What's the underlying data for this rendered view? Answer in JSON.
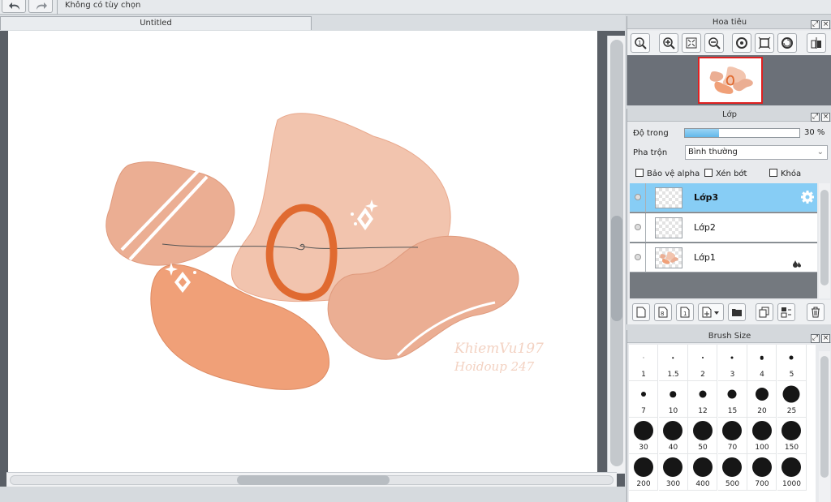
{
  "toolbar": {
    "undo_icon": "undo-arrow-icon",
    "redo_icon": "redo-arrow-icon",
    "options_text": "Không có tùy chọn"
  },
  "document": {
    "tab_title": "Untitled",
    "watermark_line1": "KhiemVu197",
    "watermark_line2": "Hoidoup 247"
  },
  "navigator": {
    "title": "Hoa tiêu",
    "tools": [
      "zoom-actual-icon",
      "zoom-in-icon",
      "fit-screen-icon",
      "zoom-out-icon",
      "rotate-left-icon",
      "fit-window-icon",
      "rotate-right-icon",
      "flip-icon"
    ]
  },
  "layers": {
    "title": "Lớp",
    "opacity_label": "Độ trong",
    "opacity_value": "30 %",
    "opacity_fraction": 0.3,
    "blend_label": "Pha trộn",
    "blend_value": "Bình thường",
    "protect_alpha_label": "Bảo vệ alpha",
    "clipping_label": "Xén bớt",
    "lock_label": "Khóa",
    "items": [
      {
        "name": "Lớp3",
        "selected": true
      },
      {
        "name": "Lớp2",
        "selected": false
      },
      {
        "name": "Lớp1",
        "selected": false
      }
    ]
  },
  "brush": {
    "title": "Brush Size",
    "sizes": [
      "1",
      "1.5",
      "2",
      "3",
      "4",
      "5",
      "7",
      "10",
      "12",
      "15",
      "20",
      "25",
      "30",
      "40",
      "50",
      "70",
      "100",
      "150",
      "200",
      "300",
      "400",
      "500",
      "700",
      "1000"
    ]
  },
  "colors": {
    "selection": "#87cdf5",
    "shape_light": "#f2c4ae",
    "shape_mid": "#ebae93",
    "shape_dark": "#f0a078",
    "ring": "#e06a30"
  }
}
